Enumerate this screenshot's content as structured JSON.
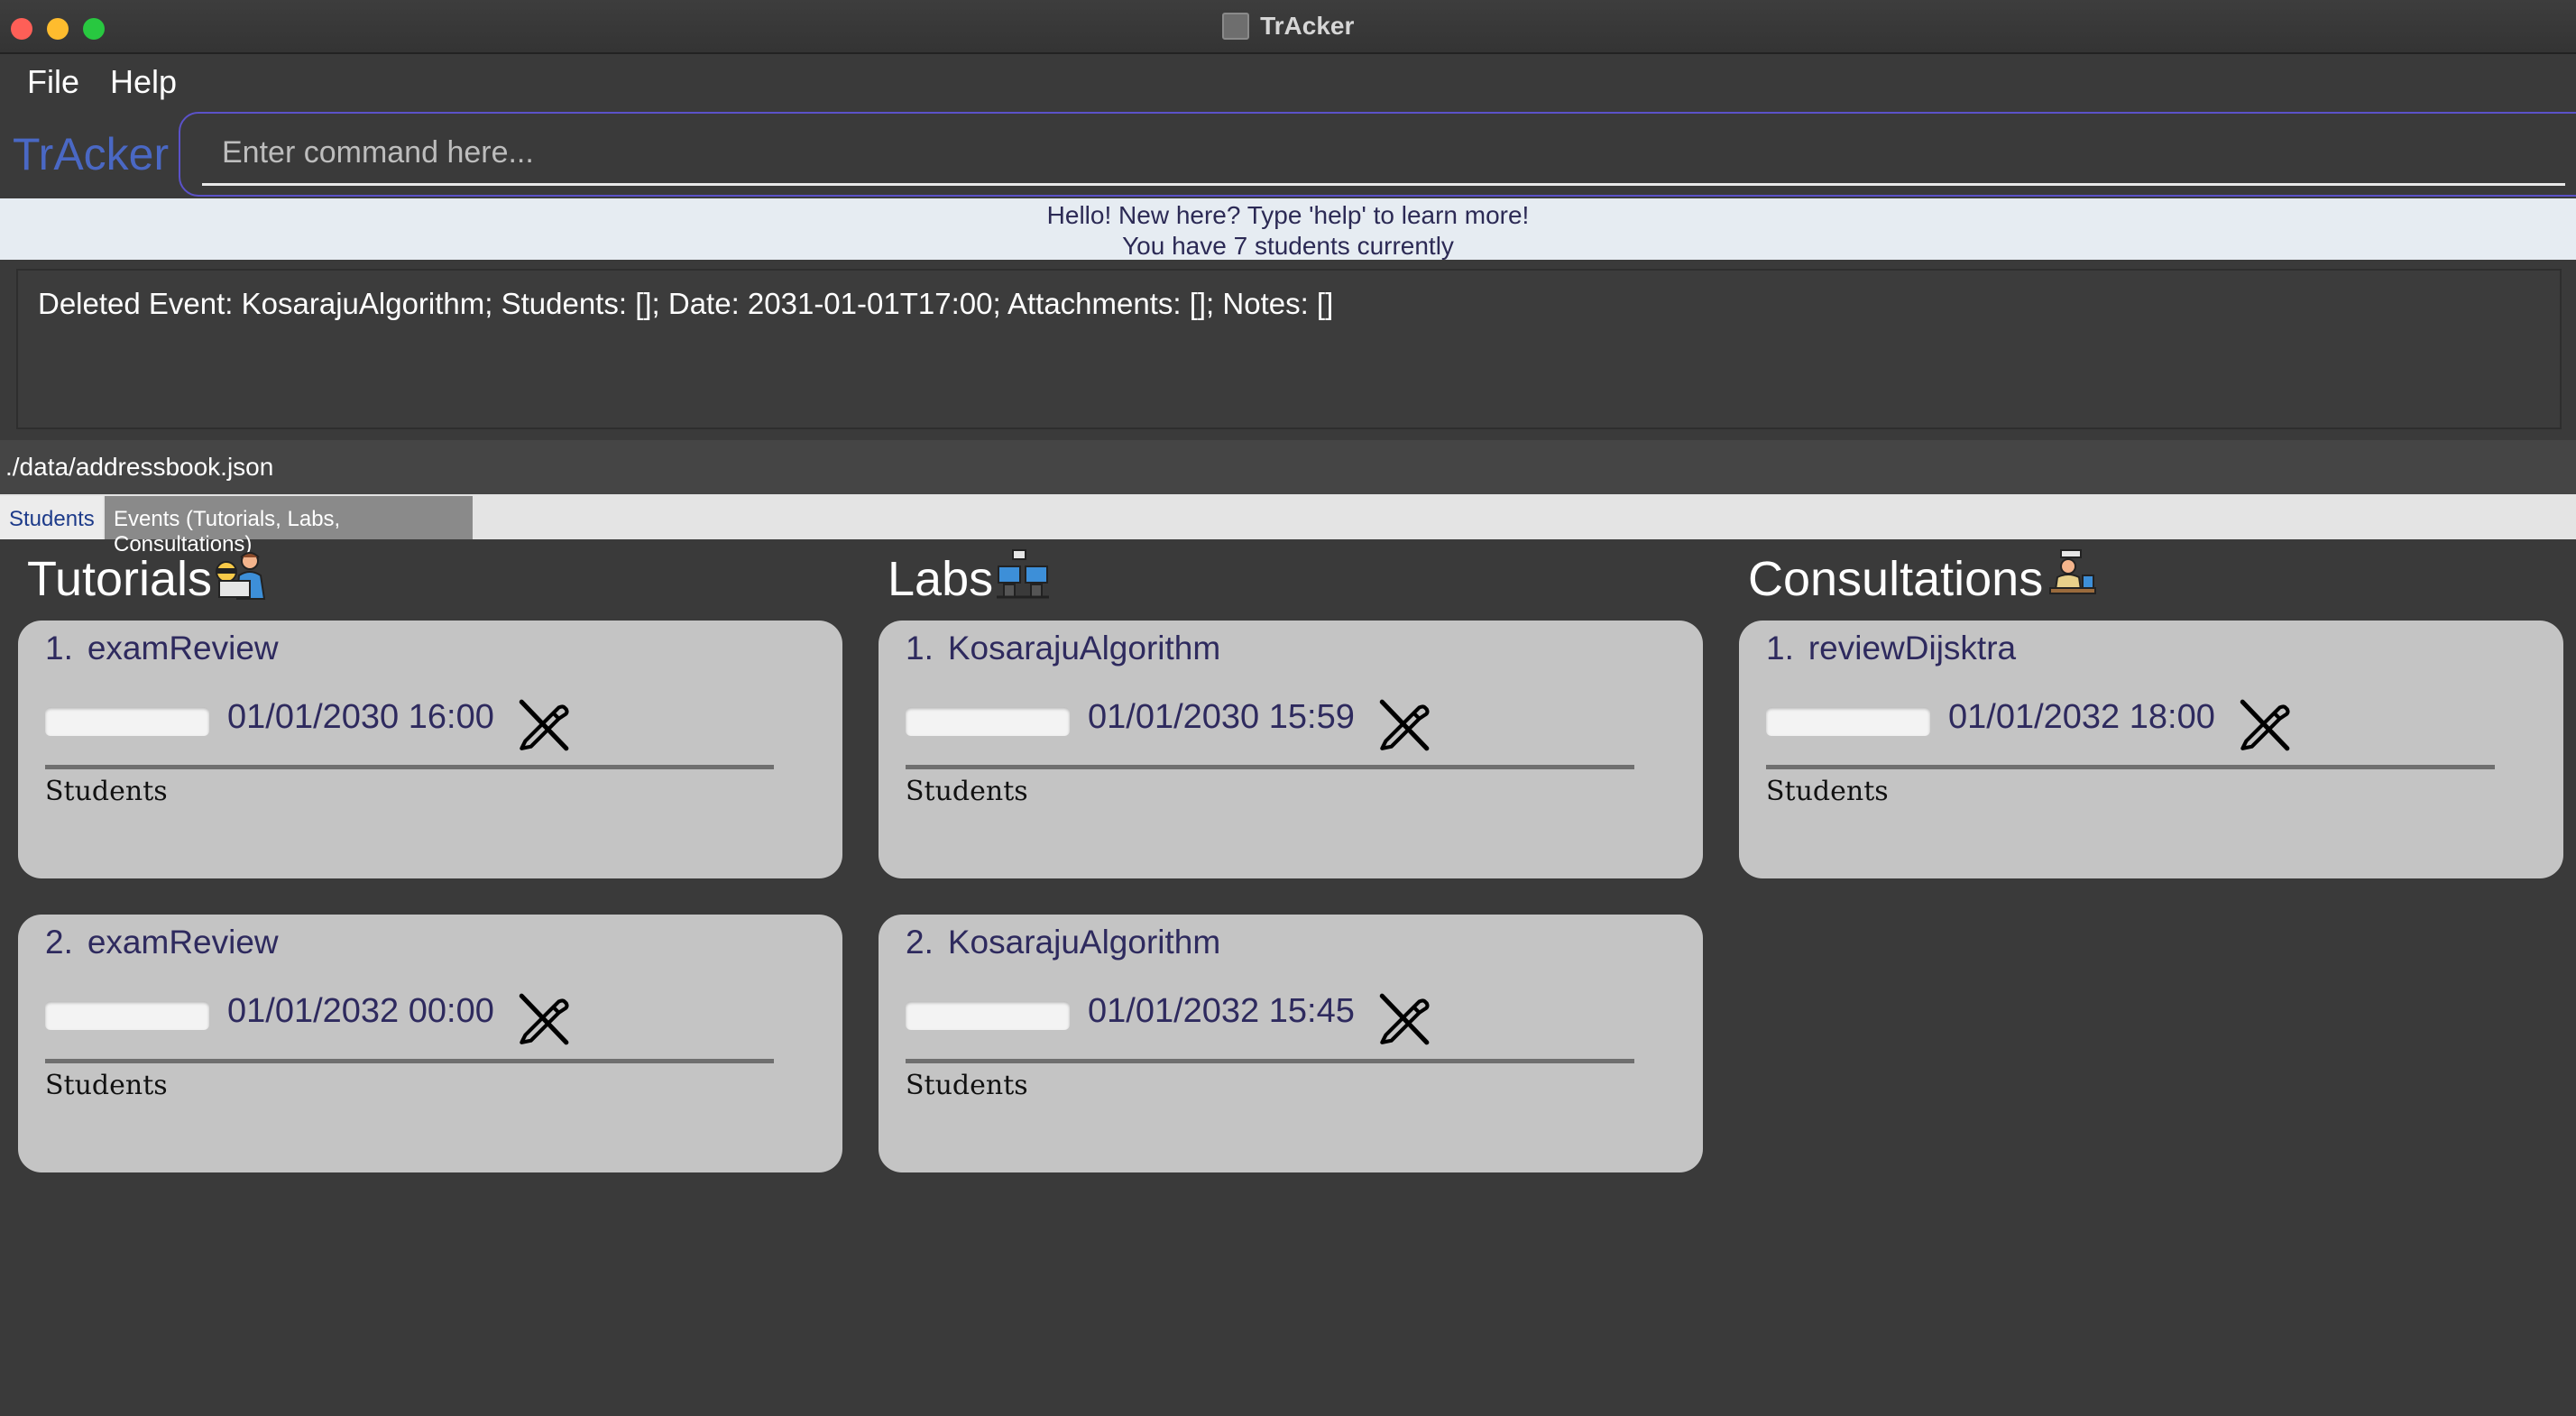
{
  "window": {
    "title": "TrAcker"
  },
  "menu": {
    "file": "File",
    "help": "Help"
  },
  "brand": "TrAcker",
  "command": {
    "placeholder": "Enter command here...",
    "value": ""
  },
  "welcome": {
    "line1": "Hello! New here? Type 'help' to learn more!",
    "line2": "You have 7 students currently"
  },
  "result": "Deleted Event: KosarajuAlgorithm; Students: []; Date: 2031-01-01T17:00; Attachments: []; Notes: []",
  "status_path": "./data/addressbook.json",
  "tabs": {
    "students": "Students",
    "events": "Events (Tutorials, Labs, Consultations)"
  },
  "columns": {
    "tutorials": {
      "heading": "Tutorials",
      "icon": "tutor-with-laptop-icon",
      "cards": [
        {
          "index": "1.",
          "name": "examReview",
          "date": "01/01/2030 16:00",
          "students_label": "Students"
        },
        {
          "index": "2.",
          "name": "examReview",
          "date": "01/01/2032 00:00",
          "students_label": "Students"
        }
      ]
    },
    "labs": {
      "heading": "Labs",
      "icon": "lab-computers-icon",
      "cards": [
        {
          "index": "1.",
          "name": "KosarajuAlgorithm",
          "date": "01/01/2030 15:59",
          "students_label": "Students"
        },
        {
          "index": "2.",
          "name": "KosarajuAlgorithm",
          "date": "01/01/2032 15:45",
          "students_label": "Students"
        }
      ]
    },
    "consultations": {
      "heading": "Consultations",
      "icon": "consultation-desk-icon",
      "cards": [
        {
          "index": "1.",
          "name": "reviewDijsktra",
          "date": "01/01/2032 18:00",
          "students_label": "Students"
        }
      ]
    }
  },
  "colors": {
    "accent": "#4a68c4",
    "command_border": "#5b52c9",
    "card_bg": "#c4c4c4",
    "card_text": "#2e2a5e",
    "background": "#3a3a3a"
  }
}
